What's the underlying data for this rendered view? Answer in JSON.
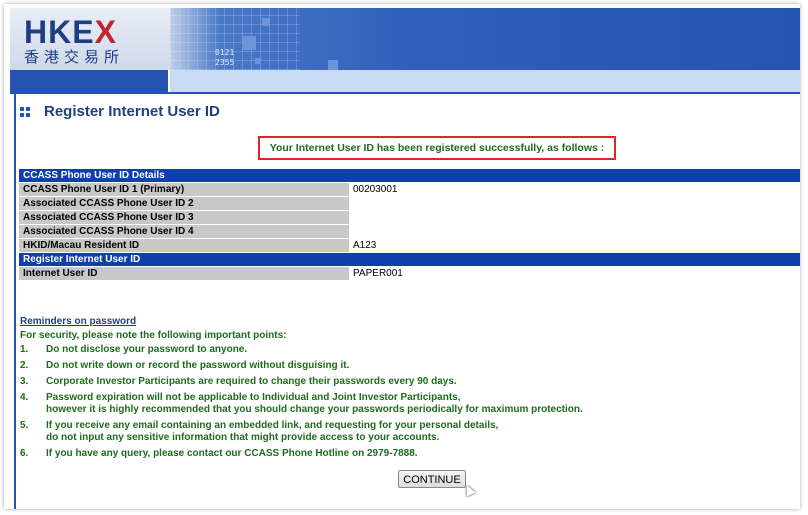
{
  "header": {
    "logo_en": "HKE",
    "logo_x": "X",
    "logo_zh": "香港交易所",
    "ticker_line1": "0121",
    "ticker_line2": "2355"
  },
  "page": {
    "title": "Register Internet User ID",
    "success_message": "Your Internet User ID has been registered successfully, as follows :"
  },
  "details": {
    "section1_title": "CCASS Phone User ID Details",
    "rows": [
      {
        "label": "CCASS Phone User ID 1 (Primary)",
        "value": "00203001"
      },
      {
        "label": "Associated CCASS Phone User ID 2",
        "value": ""
      },
      {
        "label": "Associated CCASS Phone User ID 3",
        "value": ""
      },
      {
        "label": "Associated CCASS Phone User ID 4",
        "value": ""
      },
      {
        "label": "HKID/Macau Resident ID",
        "value": "A123"
      }
    ],
    "section2_title": "Register Internet User ID",
    "internet_user_id_label": "Internet User ID",
    "internet_user_id_value": "PAPER001"
  },
  "reminders": {
    "heading": "Reminders on password",
    "intro": "For security, please note the following important points:",
    "items": [
      {
        "num": "1.",
        "line1": "Do not disclose your password to anyone.",
        "line2": ""
      },
      {
        "num": "2.",
        "line1": "Do not write down or record the password without disguising it.",
        "line2": ""
      },
      {
        "num": "3.",
        "line1": "Corporate Investor Participants are required to change their passwords every 90 days.",
        "line2": ""
      },
      {
        "num": "4.",
        "line1": "Password expiration will not be applicable to Individual and Joint Investor Participants,",
        "line2": "however it is highly recommended that you should change your passwords periodically for maximum protection."
      },
      {
        "num": "5.",
        "line1": "If you receive any email containing an embedded link, and requesting for your personal details,",
        "line2": "do not input any sensitive information that might provide access to your accounts."
      },
      {
        "num": "6.",
        "line1": "If you have any query, please contact our CCASS Phone Hotline on 2979-7888.",
        "line2": ""
      }
    ]
  },
  "actions": {
    "continue_label": "CONTINUE"
  },
  "colors": {
    "brand_blue": "#2554b0",
    "section_blue": "#0f3fa8",
    "text_green": "#1f6b1f",
    "alert_red": "#e0262b"
  }
}
